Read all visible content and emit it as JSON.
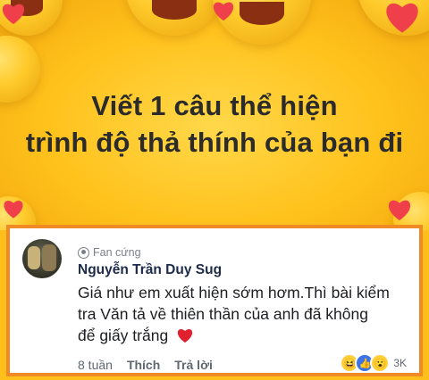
{
  "banner": {
    "line1": "Viết 1 câu thể hiện",
    "line2": "trình độ thả thính của bạn đi"
  },
  "comment": {
    "badge": "Fan cứng",
    "author": "Nguyễn Trần Duy Sug",
    "line1": "Giá như em xuất hiện sớm hơm.Thì bài kiểm",
    "line2": "tra Văn tả về thiên thần của anh đã không",
    "line3": "để giấy trắng",
    "time": "8 tuần",
    "like_label": "Thích",
    "reply_label": "Trả lời",
    "reaction_count": "3K",
    "reactions": [
      "haha-icon",
      "like-icon",
      "wow-icon"
    ]
  },
  "colors": {
    "banner_bg": "#ffc21c",
    "panel_border": "#f08a24",
    "author": "#1c2b4a",
    "heart": "#e0212f"
  }
}
